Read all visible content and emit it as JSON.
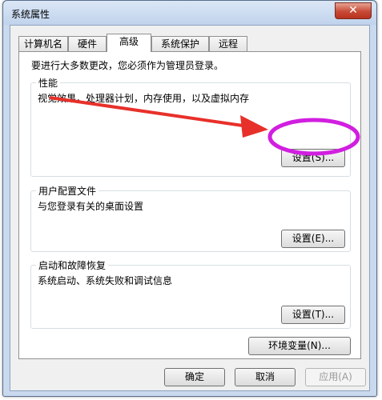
{
  "window": {
    "title": "系统属性",
    "close_symbol": "✕"
  },
  "tabs": [
    {
      "label": "计算机名"
    },
    {
      "label": "硬件"
    },
    {
      "label": "高级",
      "active": true
    },
    {
      "label": "系统保护"
    },
    {
      "label": "远程"
    }
  ],
  "admin_note": "要进行大多数更改，您必须作为管理员登录。",
  "performance": {
    "title": "性能",
    "description": "视觉效果，处理器计划，内存使用，以及虚拟内存",
    "button": "设置(S)..."
  },
  "user_profiles": {
    "title": "用户配置文件",
    "description": "与您登录有关的桌面设置",
    "button": "设置(E)..."
  },
  "startup_recovery": {
    "title": "启动和故障恢复",
    "description": "系统启动、系统失败和调试信息",
    "button": "设置(T)..."
  },
  "env_button": "环境变量(N)...",
  "footer": {
    "ok": "确定",
    "cancel": "取消",
    "apply": "应用(A)"
  },
  "colors": {
    "annotation": "#e8302a",
    "highlight": "#d11fe0",
    "close": "#c74a36"
  }
}
